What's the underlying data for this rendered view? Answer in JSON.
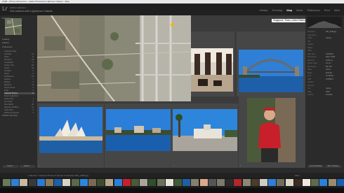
{
  "window": {
    "title": "Ch05 – Photo Library.lrcat – Adobe Photoshop Lightroom Classic – Map"
  },
  "header": {
    "logo": "Lr",
    "catalog_subtitle": "Adobe Lightroom",
    "catalog_name": "Get started with Lightroom Classic",
    "modules": [
      "Library",
      "Develop",
      "Map",
      "Book",
      "Slideshow",
      "Print",
      "Web"
    ],
    "active_module": "Map"
  },
  "left_panel": {
    "sections": [
      "Navigator",
      "Catalog",
      "Folders",
      "Collections",
      "Publish Services"
    ],
    "collection_rows": [
      {
        "label": "Collection Sets",
        "count": ""
      },
      {
        "label": "Australia",
        "count": "12"
      },
      {
        "label": "Cities",
        "count": "8"
      },
      {
        "label": "Favorites",
        "count": "24"
      },
      {
        "label": "Landmarks",
        "count": "5"
      },
      {
        "label": "Sydney Trip",
        "count": "18"
      },
      {
        "label": "Travel",
        "count": "31"
      },
      {
        "label": "Portraits",
        "count": "6"
      },
      {
        "label": "Street",
        "count": "9"
      },
      {
        "label": "Architecture",
        "count": "14"
      },
      {
        "label": "Harbour",
        "count": "7"
      },
      {
        "label": "Bridges",
        "count": "3"
      },
      {
        "label": "Beaches",
        "count": "11"
      },
      {
        "label": "Opera House",
        "count": "4"
      },
      {
        "label": "Dusk",
        "count": "2"
      },
      {
        "label": "Selected Photos",
        "count": "6"
      },
      {
        "label": "Smart Collections",
        "count": ""
      },
      {
        "label": "Colour Red",
        "count": "1"
      },
      {
        "label": "Five Stars",
        "count": "2"
      },
      {
        "label": "Past Month",
        "count": "40"
      },
      {
        "label": "Recently Modified",
        "count": "12"
      },
      {
        "label": "Video Files",
        "count": "0"
      },
      {
        "label": "Without Keywords",
        "count": "3"
      }
    ],
    "selected_index": 15,
    "import_label": "Import...",
    "export_label": "Export..."
  },
  "map": {
    "location_caption": "Singapore, Texas, United States"
  },
  "right_panel": {
    "histogram_title": "Histogram",
    "metadata": [
      {
        "k": "File Name",
        "v": "IMG_0038.jpg"
      },
      {
        "k": "Copy Name",
        "v": ""
      },
      {
        "k": "Folder",
        "v": "Sydney"
      },
      {
        "k": "Title",
        "v": ""
      },
      {
        "k": "Caption",
        "v": ""
      },
      {
        "k": "Rating",
        "v": "· · · · ·"
      },
      {
        "k": "Label",
        "v": ""
      },
      {
        "k": "Date Time",
        "v": "12/3/2019"
      },
      {
        "k": "Dimensions",
        "v": "4000 x 3000"
      },
      {
        "k": "Exposure",
        "v": "1/250 sec"
      },
      {
        "k": "Focal Length",
        "v": "24 mm"
      },
      {
        "k": "ISO Speed",
        "v": "ISO 100"
      },
      {
        "k": "Make",
        "v": "Canon"
      },
      {
        "k": "Model",
        "v": "EOS 5D"
      },
      {
        "k": "Lens",
        "v": "24-105mm"
      },
      {
        "k": "GPS",
        "v": "33.8568 S"
      },
      {
        "k": "Altitude",
        "v": ""
      },
      {
        "k": "Direction",
        "v": ""
      },
      {
        "k": "City",
        "v": "Sydney"
      },
      {
        "k": "State",
        "v": "NSW"
      },
      {
        "k": "Country",
        "v": "Australia"
      }
    ],
    "sync_label": "Sync Metadata",
    "sync_settings_label": "Sync Settings"
  },
  "filmstrip": {
    "source": "Collection / Selected Photos  6 photos /1 selected /IMG_0038.jpg",
    "filter_label": "Filter :"
  },
  "grid_tiles": [
    {
      "index": "1",
      "scene": "terrace"
    },
    {
      "index": "2",
      "scene": "bridge"
    },
    {
      "index": "3",
      "scene": "opera"
    },
    {
      "index": "4",
      "scene": "harbour"
    },
    {
      "index": "5",
      "scene": "building"
    },
    {
      "index": "6",
      "scene": "portrait"
    }
  ],
  "colors": {
    "accent": "#4a4a4a",
    "sky": "#2f7fd6",
    "water": "#1d5fa8"
  }
}
